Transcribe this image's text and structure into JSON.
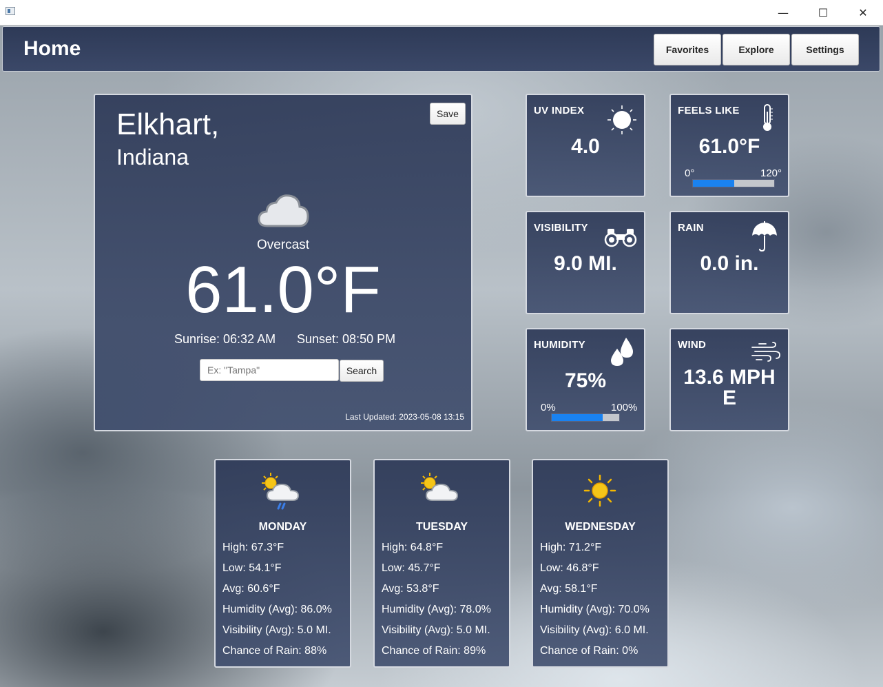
{
  "window": {
    "minimize_glyph": "—",
    "maximize_glyph": "☐",
    "close_glyph": "✕"
  },
  "header": {
    "title": "Home",
    "nav": [
      {
        "label": "Favorites"
      },
      {
        "label": "Explore"
      },
      {
        "label": "Settings"
      }
    ]
  },
  "current": {
    "city": "Elkhart,",
    "state": "Indiana",
    "save_label": "Save",
    "icon": "cloud-icon",
    "condition": "Overcast",
    "temperature": "61.0°F",
    "sunrise": "Sunrise: 06:32 AM",
    "sunset": "Sunset: 08:50 PM",
    "search_placeholder": "Ex: \"Tampa\"",
    "search_label": "Search",
    "last_updated": "Last Updated: 2023-05-08 13:15"
  },
  "stats": {
    "uv": {
      "label": "UV INDEX",
      "value": "4.0",
      "icon": "sun-icon"
    },
    "feels_like": {
      "label": "FEELS LIKE",
      "value": "61.0°F",
      "icon": "thermometer-icon",
      "min": "0°",
      "max": "120°",
      "fraction": 0.508
    },
    "visibility": {
      "label": "VISIBILITY",
      "value": "9.0 MI.",
      "icon": "binoculars-icon"
    },
    "rain": {
      "label": "RAIN",
      "value": "0.0 in.",
      "icon": "umbrella-icon"
    },
    "humidity": {
      "label": "HUMIDITY",
      "value": "75%",
      "icon": "droplets-icon",
      "min": "0%",
      "max": "100%",
      "fraction": 0.75
    },
    "wind": {
      "label": "WIND",
      "value": "13.6 MPH",
      "direction": "E",
      "icon": "wind-icon"
    }
  },
  "forecast": [
    {
      "day": "MONDAY",
      "icon": "partly-cloudy-rain-icon",
      "high": "High: 67.3°F",
      "low": "Low: 54.1°F",
      "avg": "Avg: 60.6°F",
      "humidity": "Humidity (Avg): 86.0%",
      "visibility": "Visibility (Avg): 5.0 MI.",
      "rain": "Chance of Rain: 88%"
    },
    {
      "day": "TUESDAY",
      "icon": "partly-cloudy-icon",
      "high": "High: 64.8°F",
      "low": "Low: 45.7°F",
      "avg": "Avg: 53.8°F",
      "humidity": "Humidity (Avg): 78.0%",
      "visibility": "Visibility (Avg): 5.0 MI.",
      "rain": "Chance of Rain: 89%"
    },
    {
      "day": "WEDNESDAY",
      "icon": "sunny-icon",
      "high": "High: 71.2°F",
      "low": "Low: 46.8°F",
      "avg": "Avg: 58.1°F",
      "humidity": "Humidity (Avg): 70.0%",
      "visibility": "Visibility (Avg): 6.0 MI.",
      "rain": "Chance of Rain: 0%"
    }
  ],
  "colors": {
    "panel": "#33405f",
    "accent_bar": "#1a82f0",
    "sun": "#f5b800"
  }
}
